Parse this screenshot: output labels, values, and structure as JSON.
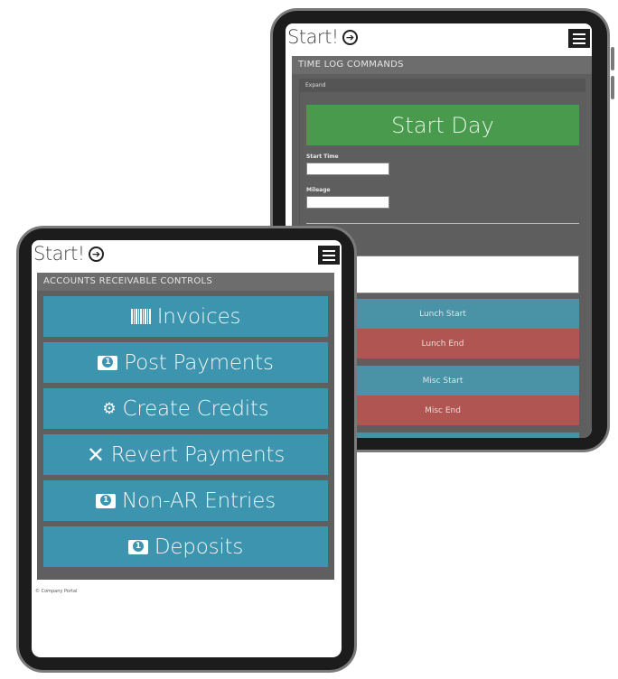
{
  "back_device": {
    "brand": "Start!",
    "panel_title": "TIME LOG COMMANDS",
    "expand_label": "Expand",
    "start_day_label": "Start Day",
    "fields": [
      {
        "label": "Start Time",
        "value": ""
      },
      {
        "label": "Mileage",
        "value": ""
      }
    ],
    "notes_value": "",
    "buttons": [
      {
        "label": "Lunch Start",
        "color": "#4a92a6"
      },
      {
        "label": "Lunch End",
        "color": "#b05552"
      },
      {
        "label": "Misc Start",
        "color": "#4a92a6"
      },
      {
        "label": "Misc End",
        "color": "#b05552"
      }
    ]
  },
  "front_device": {
    "brand": "Start!",
    "panel_title": "ACCOUNTS RECEIVABLE CONTROLS",
    "buttons": [
      {
        "label": "Invoices",
        "icon": "barcode-icon"
      },
      {
        "label": "Post Payments",
        "icon": "money-icon"
      },
      {
        "label": "Create Credits",
        "icon": "gears-icon"
      },
      {
        "label": "Revert Payments",
        "icon": "close-icon"
      },
      {
        "label": "Non-AR Entries",
        "icon": "money-icon"
      },
      {
        "label": "Deposits",
        "icon": "money-icon"
      }
    ],
    "footer": "© Company Portal"
  },
  "colors": {
    "accent_blue": "#3c94ae",
    "start_green": "#4a9a4e",
    "end_red": "#b05552",
    "panel_gray": "#5f5f5f"
  }
}
